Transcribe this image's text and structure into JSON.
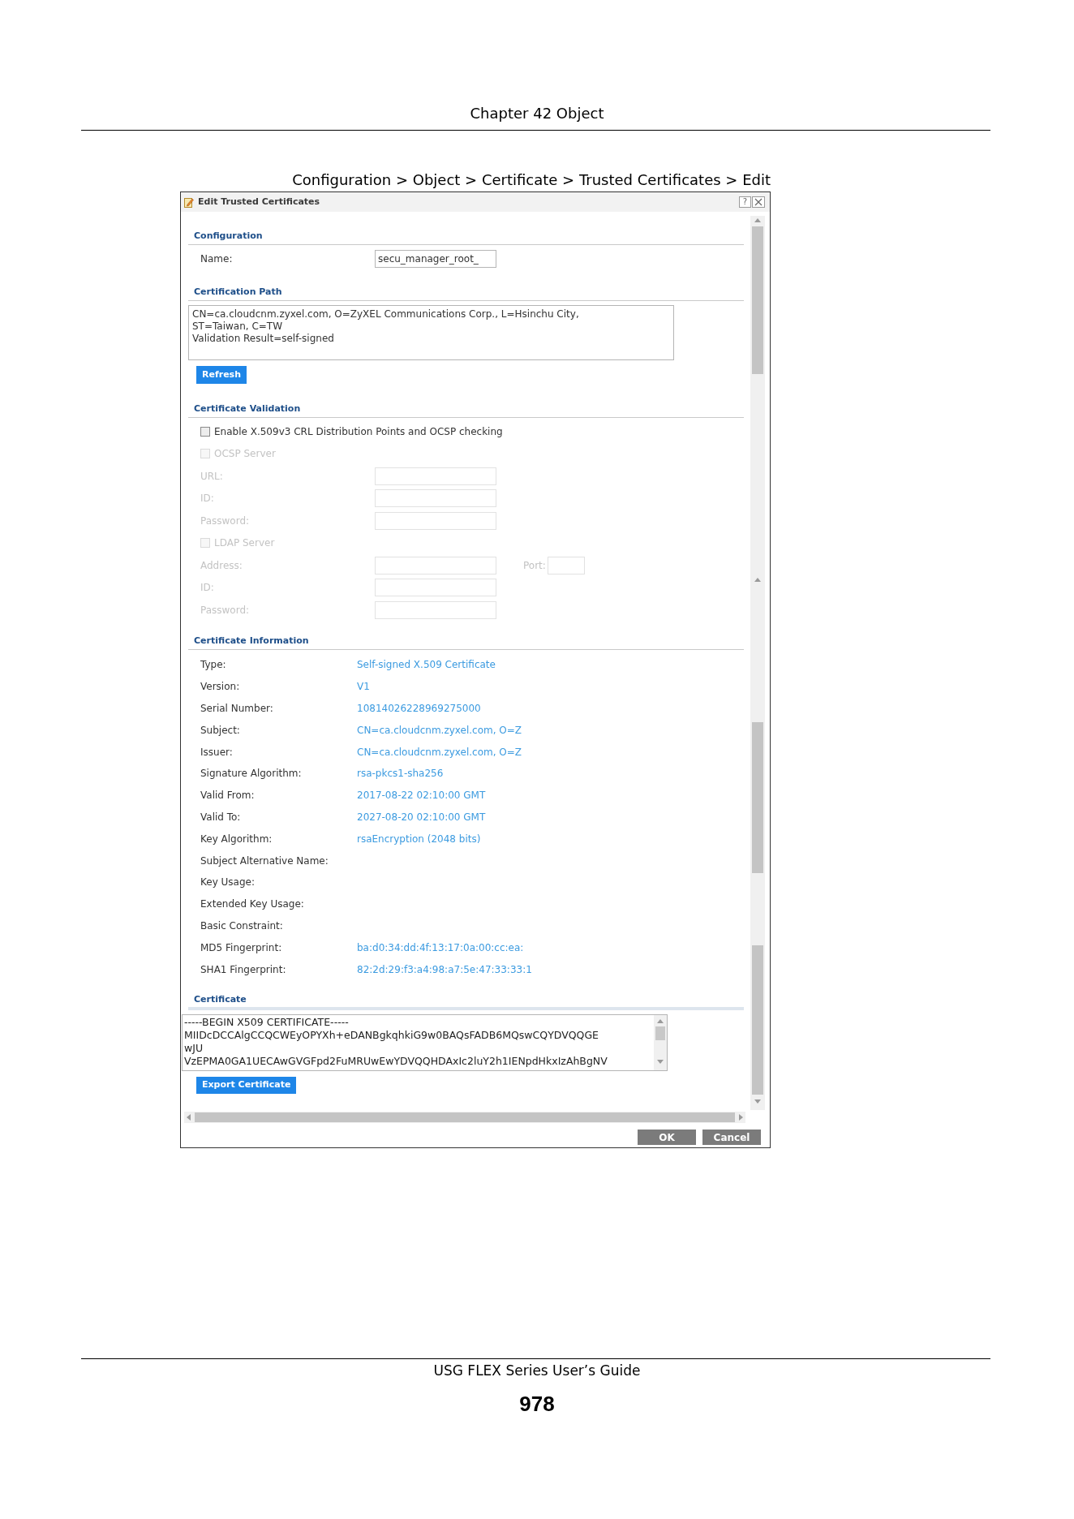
{
  "page_header": {
    "chapter": "Chapter 42 Object"
  },
  "figure_caption": "Configuration > Object > Certificate > Trusted Certificates > Edit",
  "window": {
    "title": "Edit Trusted Certificates",
    "help": "?"
  },
  "configuration": {
    "heading": "Configuration",
    "fields": [
      {
        "label": "Name:",
        "value": "secu_manager_root_"
      }
    ]
  },
  "certification_path": {
    "heading": "Certification Path",
    "lines": [
      "CN=ca.cloudcnm.zyxel.com, O=ZyXEL Communications Corp., L=Hsinchu City,",
      "ST=Taiwan, C=TW",
      "Validation Result=self-signed"
    ],
    "button": "Refresh"
  },
  "certificate_validation": {
    "heading": "Certificate Validation",
    "rows": [
      {
        "kind": "checkbox",
        "label": "Enable X.509v3 CRL Distribution Points and OCSP checking",
        "checked": false,
        "disabled": false
      },
      {
        "kind": "checkbox",
        "label": "OCSP Server",
        "checked": false,
        "disabled": true
      },
      {
        "kind": "field",
        "label": "URL:",
        "disabled": true
      },
      {
        "kind": "field",
        "label": "ID:",
        "disabled": true
      },
      {
        "kind": "field",
        "label": "Password:",
        "disabled": true
      },
      {
        "kind": "checkbox",
        "label": "LDAP Server",
        "checked": false,
        "disabled": true
      },
      {
        "kind": "field",
        "label": "Address:",
        "disabled": true,
        "port": {
          "label": "Port:"
        }
      },
      {
        "kind": "field",
        "label": "ID:",
        "disabled": true
      },
      {
        "kind": "field",
        "label": "Password:",
        "disabled": true
      }
    ]
  },
  "certificate_information": {
    "heading": "Certificate Information",
    "rows": [
      {
        "label": "Type:",
        "value": "Self-signed X.509 Certificate"
      },
      {
        "label": "Version:",
        "value": "V1"
      },
      {
        "label": "Serial Number:",
        "value": "10814026228969275000"
      },
      {
        "label": "Subject:",
        "value": "CN=ca.cloudcnm.zyxel.com, O=Z"
      },
      {
        "label": "Issuer:",
        "value": "CN=ca.cloudcnm.zyxel.com, O=Z"
      },
      {
        "label": "Signature Algorithm:",
        "value": "rsa-pkcs1-sha256"
      },
      {
        "label": "Valid From:",
        "value": "2017-08-22 02:10:00 GMT"
      },
      {
        "label": "Valid To:",
        "value": "2027-08-20 02:10:00 GMT"
      },
      {
        "label": "Key Algorithm:",
        "value": "rsaEncryption (2048 bits)"
      },
      {
        "label": "Subject Alternative Name:"
      },
      {
        "label": "Key Usage:"
      },
      {
        "label": "Extended Key Usage:"
      },
      {
        "label": "Basic Constraint:"
      },
      {
        "label": "MD5 Fingerprint:",
        "value": "ba:d0:34:dd:4f:13:17:0a:00:cc:ea:"
      },
      {
        "label": "SHA1 Fingerprint:",
        "value": "82:2d:29:f3:a4:98:a7:5e:47:33:33:1"
      }
    ]
  },
  "certificate": {
    "heading": "Certificate",
    "lines": [
      "-----BEGIN X509 CERTIFICATE-----",
      "MIIDcDCCAlgCCQCWEyOPYXh+eDANBgkqhkiG9w0BAQsFADB6MQswCQYDVQQGE",
      "wJU",
      "VzEPMA0GA1UECAwGVGFpd2FuMRUwEwYDVQQHDAxIc2luY2h1IENpdHkxIzAhBgNV"
    ],
    "button": "Export Certificate"
  },
  "buttons": [
    {
      "label": "OK"
    },
    {
      "label": "Cancel"
    }
  ],
  "page_footer": {
    "guide": "USG FLEX Series User’s Guide",
    "page": "978"
  }
}
